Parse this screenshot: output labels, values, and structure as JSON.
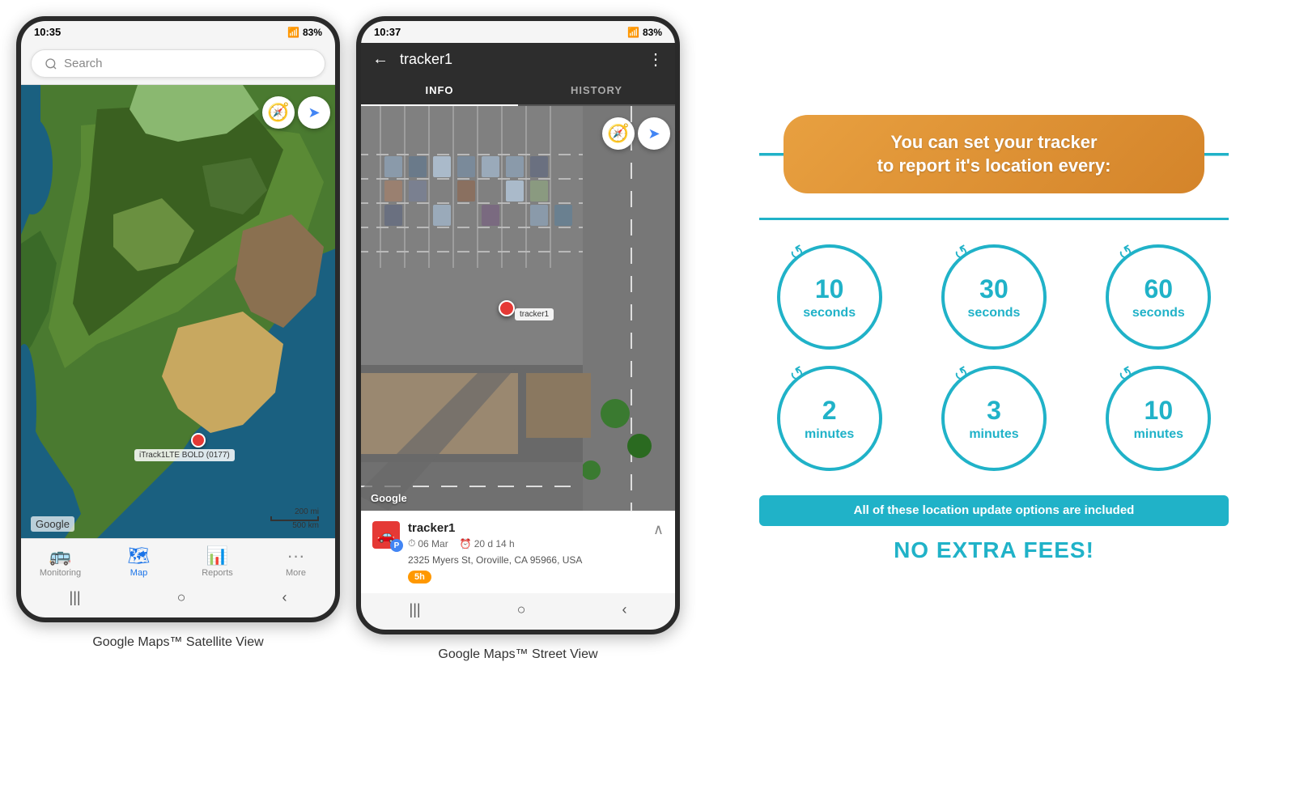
{
  "phone1": {
    "status_time": "10:35",
    "battery": "83%",
    "search_placeholder": "Search",
    "google_watermark": "Google",
    "scale_200mi": "200 mi",
    "scale_500km": "500 km",
    "marker_label": "iTrack1LTE BOLD (0177)",
    "nav_items": [
      {
        "label": "Monitoring",
        "icon": "🚌",
        "active": false
      },
      {
        "label": "Map",
        "icon": "🗺",
        "active": true
      },
      {
        "label": "Reports",
        "icon": "📊",
        "active": false
      },
      {
        "label": "More",
        "icon": "···",
        "active": false
      }
    ],
    "caption": "Google Maps™ Satellite View"
  },
  "phone2": {
    "status_time": "10:37",
    "battery": "83%",
    "header_title": "tracker1",
    "tabs": [
      {
        "label": "INFO",
        "active": true
      },
      {
        "label": "HISTORY",
        "active": false
      }
    ],
    "google_watermark": "Google",
    "tracker_name": "tracker1",
    "tracker_date": "06 Mar",
    "tracker_duration": "20 d 14 h",
    "tracker_address": "2325 Myers St, Oroville, CA 95966, USA",
    "time_badge": "5h",
    "caption": "Google Maps™ Street View"
  },
  "infographic": {
    "headline_line1": "You can set your tracker",
    "headline_line2": "to report it's location every:",
    "teal_color": "#20b2c8",
    "orange_color": "#e8922a",
    "circles": [
      {
        "number": "10",
        "unit": "seconds"
      },
      {
        "number": "30",
        "unit": "seconds"
      },
      {
        "number": "60",
        "unit": "seconds"
      },
      {
        "number": "2",
        "unit": "minutes"
      },
      {
        "number": "3",
        "unit": "minutes"
      },
      {
        "number": "10",
        "unit": "minutes"
      }
    ],
    "banner_text": "All of these location update options are included",
    "no_fees_text": "NO EXTRA FEES!"
  }
}
